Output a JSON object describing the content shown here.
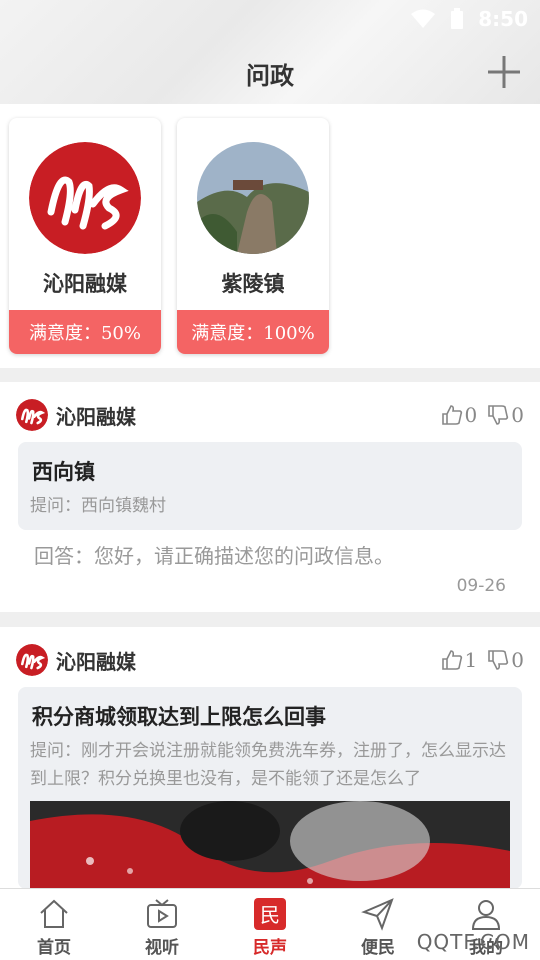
{
  "status": {
    "time": "8:50"
  },
  "header": {
    "title": "问政"
  },
  "units": [
    {
      "name": "沁阳融媒",
      "satisfaction": "满意度：50%"
    },
    {
      "name": "紫陵镇",
      "satisfaction": "满意度：100%"
    }
  ],
  "posts": [
    {
      "author": "沁阳融媒",
      "likes": "0",
      "dislikes": "0",
      "title": "西向镇",
      "question": "提问：西向镇魏村",
      "answer": "回答：您好，请正确描述您的问政信息。",
      "date": "09-26"
    },
    {
      "author": "沁阳融媒",
      "likes": "1",
      "dislikes": "0",
      "title": "积分商城领取达到上限怎么回事",
      "question": "提问：刚才开会说注册就能领免费洗车券，注册了，怎么显示达到上限？积分兑换里也没有，是不能领了还是怎么了"
    }
  ],
  "nav": [
    {
      "label": "首页",
      "icon": "home-icon"
    },
    {
      "label": "视听",
      "icon": "tv-icon"
    },
    {
      "label": "民声",
      "icon": "minsheng-icon",
      "active": true
    },
    {
      "label": "便民",
      "icon": "send-icon"
    },
    {
      "label": "我的",
      "icon": "user-icon"
    }
  ],
  "watermark": "QQTF.COM",
  "colors": {
    "accent": "#f46464",
    "brand_red": "#d72a2a"
  }
}
